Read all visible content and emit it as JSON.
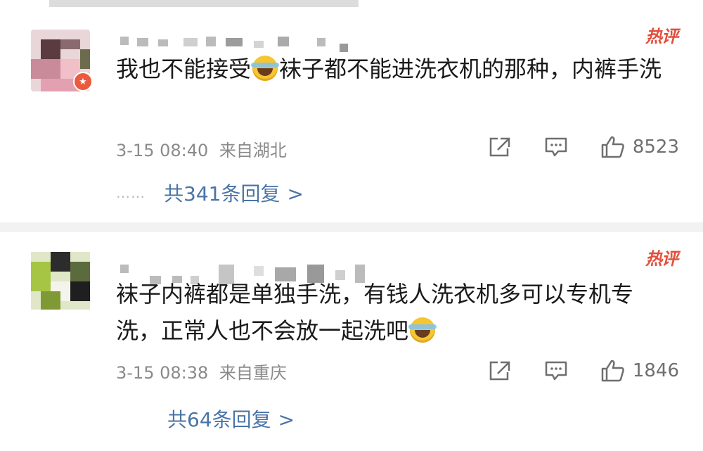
{
  "comments": [
    {
      "hot_label": "热评",
      "text_before_emoji": "我也不能接受",
      "text_after_emoji": "袜子都不能进洗衣机的那种，内裤手洗",
      "emoji": "laughing-tears-emoji",
      "timestamp": "3-15 08:40",
      "location": "来自湖北",
      "likes": "8523",
      "replies_dots": "……",
      "replies_label": "共341条回复",
      "replies_arrow": ">"
    },
    {
      "hot_label": "热评",
      "text_before_emoji": "袜子内裤都是单独手洗，有钱人洗衣机多可以专机专洗，正常人也不会放一起洗吧",
      "text_after_emoji": "",
      "emoji": "laughing-tears-emoji",
      "timestamp": "3-15 08:38",
      "location": "来自重庆",
      "likes": "1846",
      "replies_label": "共64条回复",
      "replies_arrow": ">"
    }
  ],
  "icons": {
    "share": "share-icon",
    "comment": "comment-icon",
    "like": "like-icon"
  },
  "colors": {
    "hot": "#e24e3c",
    "link": "#4a74a6",
    "meta": "#8a8a8a",
    "divider": "#f2f2f2"
  }
}
